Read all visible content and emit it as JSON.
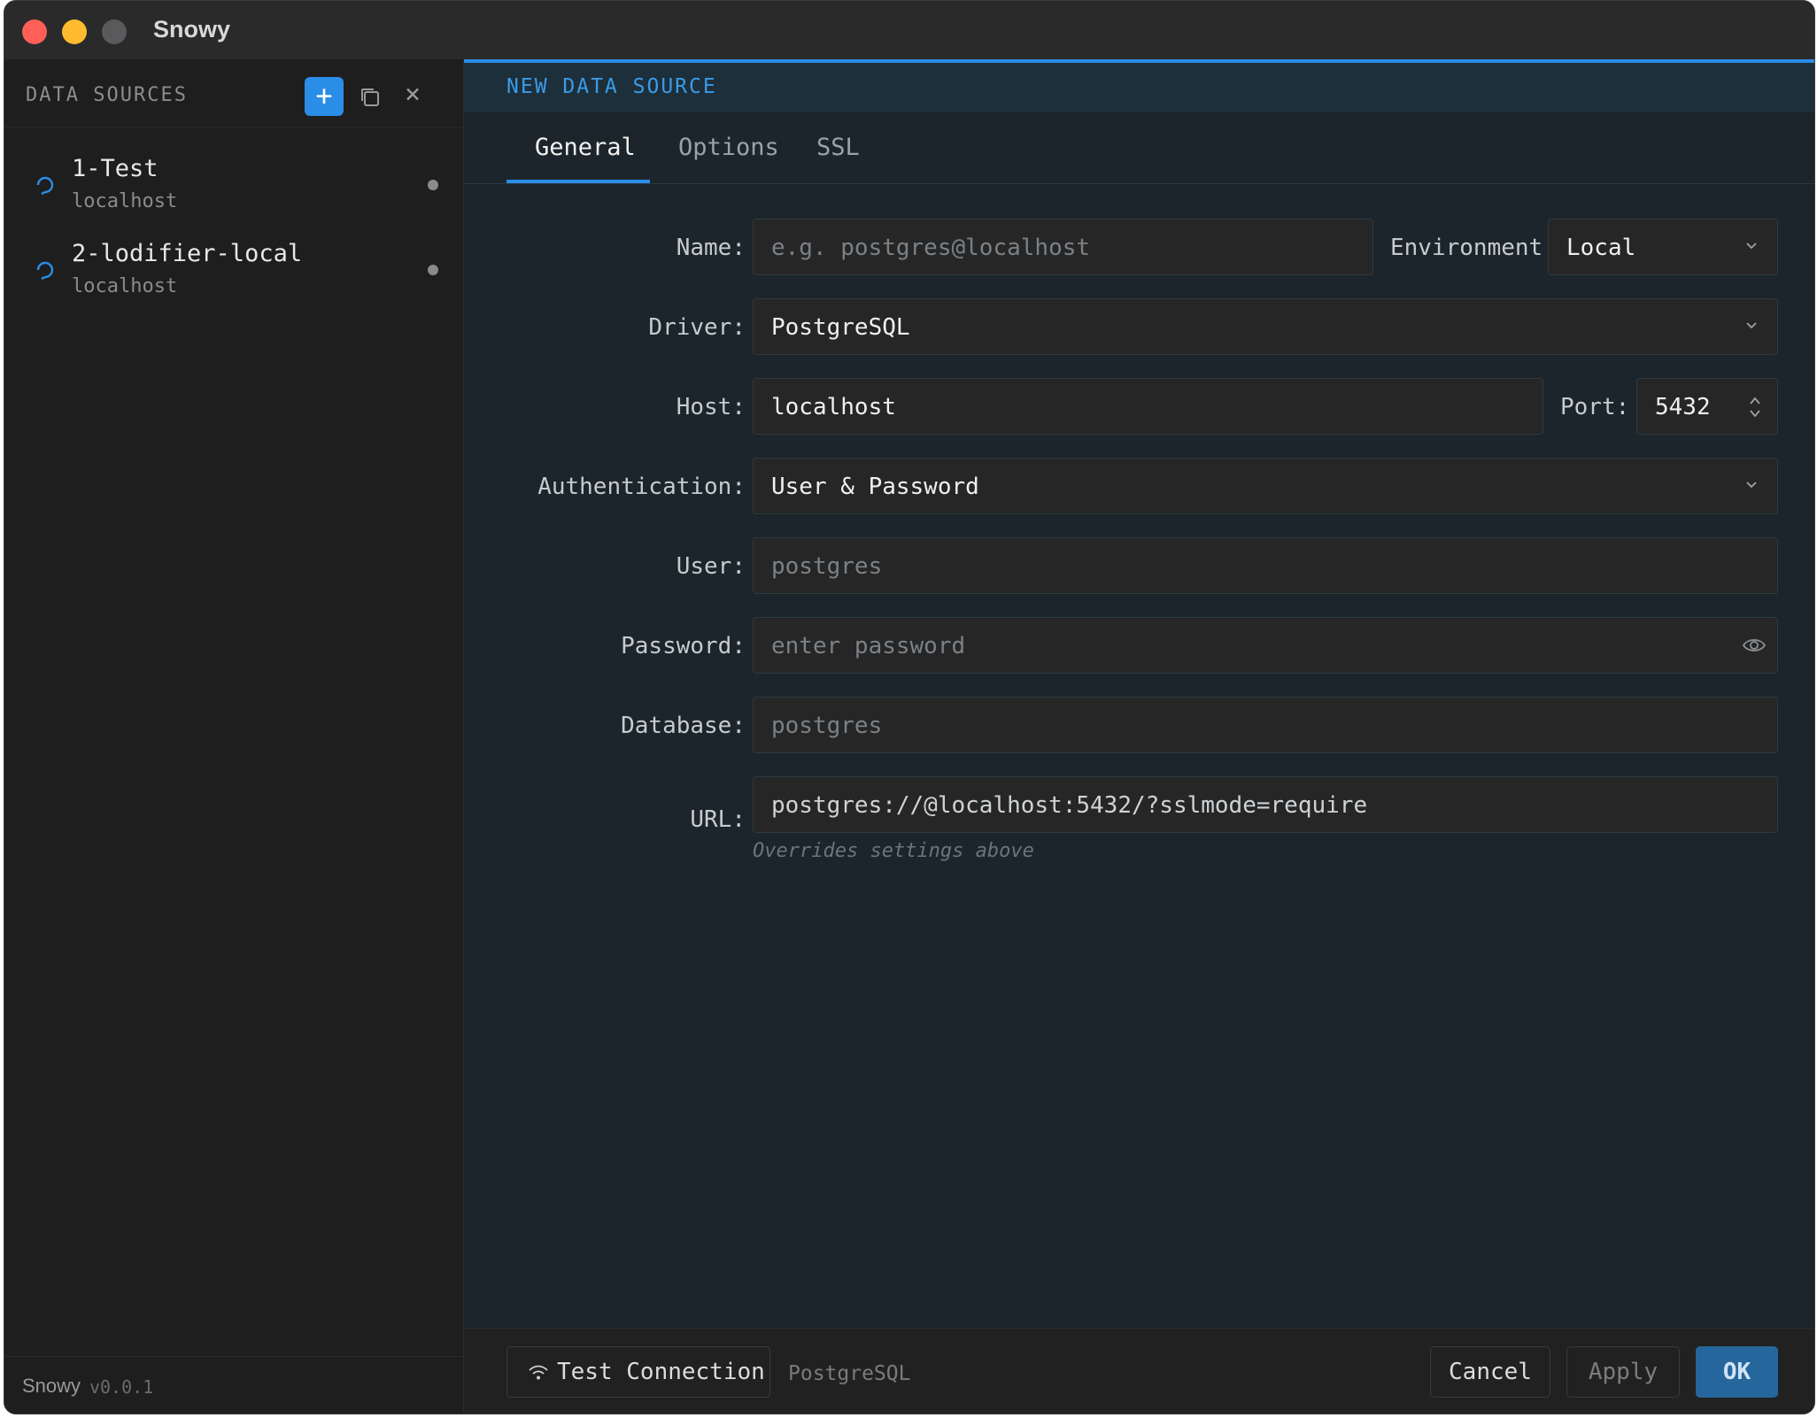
{
  "window": {
    "title": "Snowy"
  },
  "sidebar": {
    "header": "DATA SOURCES",
    "add_label": "+",
    "close_label": "×",
    "items": [
      {
        "name": "1-Test",
        "host": "localhost"
      },
      {
        "name": "2-lodifier-local",
        "host": "localhost"
      }
    ],
    "footer": {
      "brand": "Snowy",
      "version": "v0.0.1"
    }
  },
  "main": {
    "title": "NEW DATA SOURCE",
    "tabs": [
      {
        "label": "General",
        "active": true
      },
      {
        "label": "Options",
        "active": false
      },
      {
        "label": "SSL",
        "active": false
      }
    ],
    "form": {
      "name_label": "Name:",
      "name_placeholder": "e.g. postgres@localhost",
      "environment_label": "Environment:",
      "environment_value": "Local",
      "driver_label": "Driver:",
      "driver_value": "PostgreSQL",
      "host_label": "Host:",
      "host_value": "localhost",
      "port_label": "Port:",
      "port_value": "5432",
      "auth_label": "Authentication:",
      "auth_value": "User & Password",
      "user_label": "User:",
      "user_placeholder": "postgres",
      "password_label": "Password:",
      "password_placeholder": "enter password",
      "database_label": "Database:",
      "database_placeholder": "postgres",
      "url_label": "URL:",
      "url_value": "postgres://@localhost:5432/?sslmode=require",
      "url_hint": "Overrides settings above"
    },
    "footer": {
      "test_connection": "Test Connection",
      "driver_info": "PostgreSQL",
      "cancel": "Cancel",
      "apply": "Apply",
      "ok": "OK"
    }
  },
  "colors": {
    "accent": "#2a8de6",
    "ok_button": "#25669c"
  }
}
